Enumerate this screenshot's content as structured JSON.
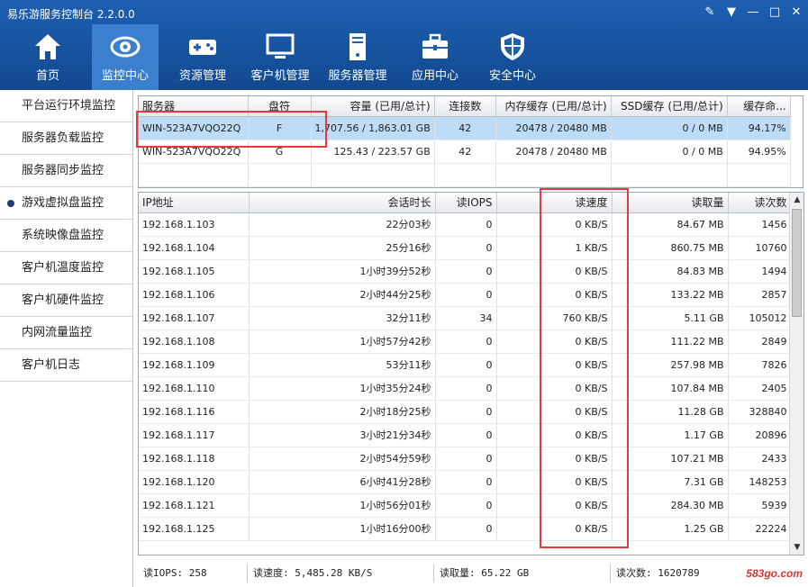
{
  "window": {
    "title": "易乐游服务控制台 2.2.0.0"
  },
  "toolbar": [
    {
      "label": "首页",
      "icon": "home-icon"
    },
    {
      "label": "监控中心",
      "icon": "eye-icon",
      "active": true
    },
    {
      "label": "资源管理",
      "icon": "gamepad-icon"
    },
    {
      "label": "客户机管理",
      "icon": "monitor-icon"
    },
    {
      "label": "服务器管理",
      "icon": "server-icon"
    },
    {
      "label": "应用中心",
      "icon": "toolbox-icon"
    },
    {
      "label": "安全中心",
      "icon": "shield-icon"
    }
  ],
  "sidebar": {
    "items": [
      "平台运行环境监控",
      "服务器负载监控",
      "服务器同步监控",
      "游戏虚拟盘监控",
      "系统映像盘监控",
      "客户机温度监控",
      "客户机硬件监控",
      "内网流量监控",
      "客户机日志"
    ],
    "active_index": 3
  },
  "disk_table": {
    "headers": [
      "服务器",
      "盘符",
      "容量 (已用/总计)",
      "连接数",
      "内存缓存 (已用/总计)",
      "SSD缓存 (已用/总计)",
      "缓存命..."
    ],
    "rows": [
      [
        "WIN-523A7VQO22Q",
        "F",
        "1,707.56 / 1,863.01 GB",
        "42",
        "20478 / 20480 MB",
        "0 / 0 MB",
        "94.17%"
      ],
      [
        "WIN-523A7VQO22Q",
        "G",
        "125.43 / 223.57 GB",
        "42",
        "20478 / 20480 MB",
        "0 / 0 MB",
        "94.95%"
      ]
    ]
  },
  "client_table": {
    "headers": [
      "IP地址",
      "会话时长",
      "读IOPS",
      "读速度",
      "读取量",
      "读次数"
    ],
    "rows": [
      [
        "192.168.1.103",
        "22分03秒",
        "0",
        "0 KB/S",
        "84.67 MB",
        "1456"
      ],
      [
        "192.168.1.104",
        "25分16秒",
        "0",
        "1 KB/S",
        "860.75 MB",
        "10760"
      ],
      [
        "192.168.1.105",
        "1小时39分52秒",
        "0",
        "0 KB/S",
        "84.83 MB",
        "1494"
      ],
      [
        "192.168.1.106",
        "2小时44分25秒",
        "0",
        "0 KB/S",
        "133.22 MB",
        "2857"
      ],
      [
        "192.168.1.107",
        "32分11秒",
        "34",
        "760 KB/S",
        "5.11 GB",
        "105012"
      ],
      [
        "192.168.1.108",
        "1小时57分42秒",
        "0",
        "0 KB/S",
        "111.22 MB",
        "2849"
      ],
      [
        "192.168.1.109",
        "53分11秒",
        "0",
        "0 KB/S",
        "257.98 MB",
        "7826"
      ],
      [
        "192.168.1.110",
        "1小时35分24秒",
        "0",
        "0 KB/S",
        "107.84 MB",
        "2405"
      ],
      [
        "192.168.1.116",
        "2小时18分25秒",
        "0",
        "0 KB/S",
        "11.28 GB",
        "328840"
      ],
      [
        "192.168.1.117",
        "3小时21分34秒",
        "0",
        "0 KB/S",
        "1.17 GB",
        "20896"
      ],
      [
        "192.168.1.118",
        "2小时54分59秒",
        "0",
        "0 KB/S",
        "107.21 MB",
        "2433"
      ],
      [
        "192.168.1.120",
        "6小时41分28秒",
        "0",
        "0 KB/S",
        "7.31 GB",
        "148253"
      ],
      [
        "192.168.1.121",
        "1小时56分01秒",
        "0",
        "0 KB/S",
        "284.30 MB",
        "5939"
      ],
      [
        "192.168.1.125",
        "1小时16分00秒",
        "0",
        "0 KB/S",
        "1.25 GB",
        "22224"
      ]
    ]
  },
  "status": {
    "iops": "读IOPS: 258",
    "speed": "读速度: 5,485.28 KB/S",
    "volume": "读取量: 65.22 GB",
    "count": "读次数: 1620789"
  },
  "watermark": "583go.com",
  "colors": {
    "toolbar_bg": "#1d5fb2",
    "toolbar_active": "#3b7fcf",
    "selected_row": "#bfdcf7",
    "highlight": "#e23b3b"
  }
}
